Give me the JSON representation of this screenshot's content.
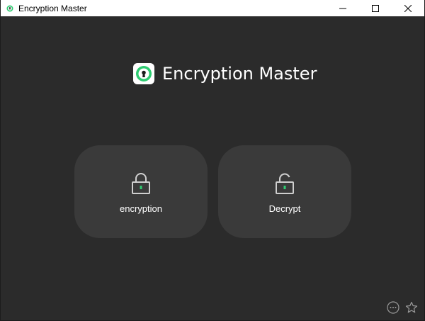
{
  "window": {
    "title": "Encryption Master",
    "controls": [
      "minimize-icon",
      "maximize-icon",
      "close-icon"
    ]
  },
  "header": {
    "app_name": "Encryption Master",
    "logo_icon": "keyhole-icon"
  },
  "actions": [
    {
      "label": "encryption",
      "icon": "lock-closed-icon"
    },
    {
      "label": "Decrypt",
      "icon": "lock-open-icon"
    }
  ],
  "footer_icons": [
    "more-icon",
    "star-icon"
  ],
  "colors": {
    "background": "#2b2b2b",
    "card": "#3a3a3a",
    "accent_green": "#2ecc71",
    "text": "#ffffff"
  }
}
